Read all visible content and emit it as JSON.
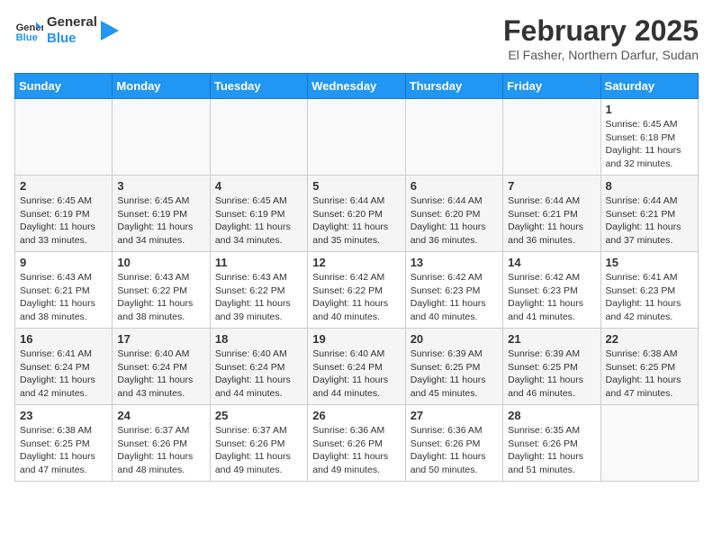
{
  "header": {
    "logo_line1": "General",
    "logo_line2": "Blue",
    "month_year": "February 2025",
    "location": "El Fasher, Northern Darfur, Sudan"
  },
  "weekdays": [
    "Sunday",
    "Monday",
    "Tuesday",
    "Wednesday",
    "Thursday",
    "Friday",
    "Saturday"
  ],
  "weeks": [
    [
      {
        "day": "",
        "info": ""
      },
      {
        "day": "",
        "info": ""
      },
      {
        "day": "",
        "info": ""
      },
      {
        "day": "",
        "info": ""
      },
      {
        "day": "",
        "info": ""
      },
      {
        "day": "",
        "info": ""
      },
      {
        "day": "1",
        "info": "Sunrise: 6:45 AM\nSunset: 6:18 PM\nDaylight: 11 hours\nand 32 minutes."
      }
    ],
    [
      {
        "day": "2",
        "info": "Sunrise: 6:45 AM\nSunset: 6:19 PM\nDaylight: 11 hours\nand 33 minutes."
      },
      {
        "day": "3",
        "info": "Sunrise: 6:45 AM\nSunset: 6:19 PM\nDaylight: 11 hours\nand 34 minutes."
      },
      {
        "day": "4",
        "info": "Sunrise: 6:45 AM\nSunset: 6:19 PM\nDaylight: 11 hours\nand 34 minutes."
      },
      {
        "day": "5",
        "info": "Sunrise: 6:44 AM\nSunset: 6:20 PM\nDaylight: 11 hours\nand 35 minutes."
      },
      {
        "day": "6",
        "info": "Sunrise: 6:44 AM\nSunset: 6:20 PM\nDaylight: 11 hours\nand 36 minutes."
      },
      {
        "day": "7",
        "info": "Sunrise: 6:44 AM\nSunset: 6:21 PM\nDaylight: 11 hours\nand 36 minutes."
      },
      {
        "day": "8",
        "info": "Sunrise: 6:44 AM\nSunset: 6:21 PM\nDaylight: 11 hours\nand 37 minutes."
      }
    ],
    [
      {
        "day": "9",
        "info": "Sunrise: 6:43 AM\nSunset: 6:21 PM\nDaylight: 11 hours\nand 38 minutes."
      },
      {
        "day": "10",
        "info": "Sunrise: 6:43 AM\nSunset: 6:22 PM\nDaylight: 11 hours\nand 38 minutes."
      },
      {
        "day": "11",
        "info": "Sunrise: 6:43 AM\nSunset: 6:22 PM\nDaylight: 11 hours\nand 39 minutes."
      },
      {
        "day": "12",
        "info": "Sunrise: 6:42 AM\nSunset: 6:22 PM\nDaylight: 11 hours\nand 40 minutes."
      },
      {
        "day": "13",
        "info": "Sunrise: 6:42 AM\nSunset: 6:23 PM\nDaylight: 11 hours\nand 40 minutes."
      },
      {
        "day": "14",
        "info": "Sunrise: 6:42 AM\nSunset: 6:23 PM\nDaylight: 11 hours\nand 41 minutes."
      },
      {
        "day": "15",
        "info": "Sunrise: 6:41 AM\nSunset: 6:23 PM\nDaylight: 11 hours\nand 42 minutes."
      }
    ],
    [
      {
        "day": "16",
        "info": "Sunrise: 6:41 AM\nSunset: 6:24 PM\nDaylight: 11 hours\nand 42 minutes."
      },
      {
        "day": "17",
        "info": "Sunrise: 6:40 AM\nSunset: 6:24 PM\nDaylight: 11 hours\nand 43 minutes."
      },
      {
        "day": "18",
        "info": "Sunrise: 6:40 AM\nSunset: 6:24 PM\nDaylight: 11 hours\nand 44 minutes."
      },
      {
        "day": "19",
        "info": "Sunrise: 6:40 AM\nSunset: 6:24 PM\nDaylight: 11 hours\nand 44 minutes."
      },
      {
        "day": "20",
        "info": "Sunrise: 6:39 AM\nSunset: 6:25 PM\nDaylight: 11 hours\nand 45 minutes."
      },
      {
        "day": "21",
        "info": "Sunrise: 6:39 AM\nSunset: 6:25 PM\nDaylight: 11 hours\nand 46 minutes."
      },
      {
        "day": "22",
        "info": "Sunrise: 6:38 AM\nSunset: 6:25 PM\nDaylight: 11 hours\nand 47 minutes."
      }
    ],
    [
      {
        "day": "23",
        "info": "Sunrise: 6:38 AM\nSunset: 6:25 PM\nDaylight: 11 hours\nand 47 minutes."
      },
      {
        "day": "24",
        "info": "Sunrise: 6:37 AM\nSunset: 6:26 PM\nDaylight: 11 hours\nand 48 minutes."
      },
      {
        "day": "25",
        "info": "Sunrise: 6:37 AM\nSunset: 6:26 PM\nDaylight: 11 hours\nand 49 minutes."
      },
      {
        "day": "26",
        "info": "Sunrise: 6:36 AM\nSunset: 6:26 PM\nDaylight: 11 hours\nand 49 minutes."
      },
      {
        "day": "27",
        "info": "Sunrise: 6:36 AM\nSunset: 6:26 PM\nDaylight: 11 hours\nand 50 minutes."
      },
      {
        "day": "28",
        "info": "Sunrise: 6:35 AM\nSunset: 6:26 PM\nDaylight: 11 hours\nand 51 minutes."
      },
      {
        "day": "",
        "info": ""
      }
    ]
  ]
}
